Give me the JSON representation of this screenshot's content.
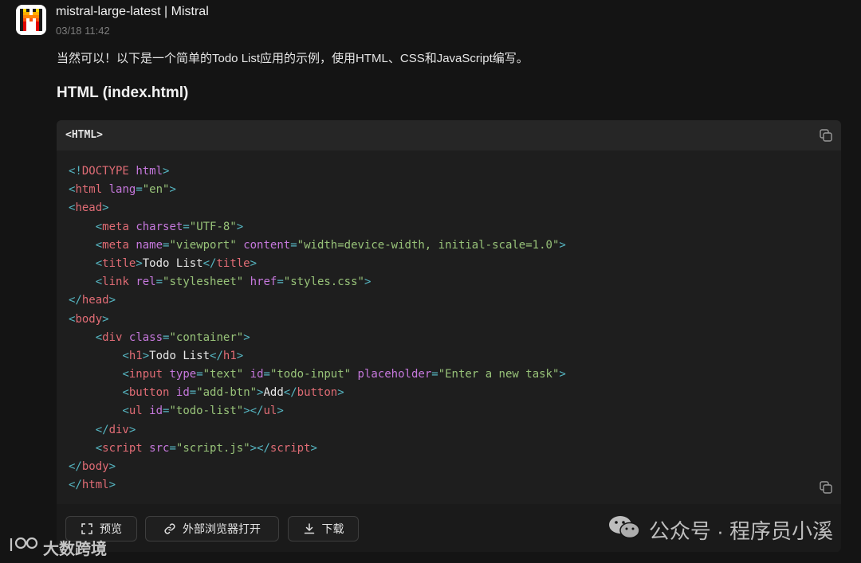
{
  "message": {
    "model_name": "mistral-large-latest | Mistral",
    "time": "03/18 11:42",
    "intro": "当然可以！以下是一个简单的Todo List应用的示例，使用HTML、CSS和JavaScript编写。",
    "section_title": "HTML (index.html)"
  },
  "code_block": {
    "language_label": "<HTML>",
    "lines": [
      [
        [
          "b",
          "<!"
        ],
        [
          "tg",
          "DOCTYPE"
        ],
        [
          "t",
          " "
        ],
        [
          "a",
          "html"
        ],
        [
          "b",
          ">"
        ]
      ],
      [
        [
          "b",
          "<"
        ],
        [
          "tg",
          "html"
        ],
        [
          "t",
          " "
        ],
        [
          "a",
          "lang"
        ],
        [
          "b",
          "="
        ],
        [
          "s",
          "\"en\""
        ],
        [
          "b",
          ">"
        ]
      ],
      [
        [
          "b",
          "<"
        ],
        [
          "tg",
          "head"
        ],
        [
          "b",
          ">"
        ]
      ],
      [
        [
          "t",
          "    "
        ],
        [
          "b",
          "<"
        ],
        [
          "tg",
          "meta"
        ],
        [
          "t",
          " "
        ],
        [
          "a",
          "charset"
        ],
        [
          "b",
          "="
        ],
        [
          "s",
          "\"UTF-8\""
        ],
        [
          "b",
          ">"
        ]
      ],
      [
        [
          "t",
          "    "
        ],
        [
          "b",
          "<"
        ],
        [
          "tg",
          "meta"
        ],
        [
          "t",
          " "
        ],
        [
          "a",
          "name"
        ],
        [
          "b",
          "="
        ],
        [
          "s",
          "\"viewport\""
        ],
        [
          "t",
          " "
        ],
        [
          "a",
          "content"
        ],
        [
          "b",
          "="
        ],
        [
          "s",
          "\"width=device-width, initial-scale=1.0\""
        ],
        [
          "b",
          ">"
        ]
      ],
      [
        [
          "t",
          "    "
        ],
        [
          "b",
          "<"
        ],
        [
          "tg",
          "title"
        ],
        [
          "b",
          ">"
        ],
        [
          "t",
          "Todo List"
        ],
        [
          "b",
          "</"
        ],
        [
          "tg",
          "title"
        ],
        [
          "b",
          ">"
        ]
      ],
      [
        [
          "t",
          "    "
        ],
        [
          "b",
          "<"
        ],
        [
          "tg",
          "link"
        ],
        [
          "t",
          " "
        ],
        [
          "a",
          "rel"
        ],
        [
          "b",
          "="
        ],
        [
          "s",
          "\"stylesheet\""
        ],
        [
          "t",
          " "
        ],
        [
          "a",
          "href"
        ],
        [
          "b",
          "="
        ],
        [
          "s",
          "\"styles.css\""
        ],
        [
          "b",
          ">"
        ]
      ],
      [
        [
          "b",
          "</"
        ],
        [
          "tg",
          "head"
        ],
        [
          "b",
          ">"
        ]
      ],
      [
        [
          "b",
          "<"
        ],
        [
          "tg",
          "body"
        ],
        [
          "b",
          ">"
        ]
      ],
      [
        [
          "t",
          "    "
        ],
        [
          "b",
          "<"
        ],
        [
          "tg",
          "div"
        ],
        [
          "t",
          " "
        ],
        [
          "a",
          "class"
        ],
        [
          "b",
          "="
        ],
        [
          "s",
          "\"container\""
        ],
        [
          "b",
          ">"
        ]
      ],
      [
        [
          "t",
          "        "
        ],
        [
          "b",
          "<"
        ],
        [
          "tg",
          "h1"
        ],
        [
          "b",
          ">"
        ],
        [
          "t",
          "Todo List"
        ],
        [
          "b",
          "</"
        ],
        [
          "tg",
          "h1"
        ],
        [
          "b",
          ">"
        ]
      ],
      [
        [
          "t",
          "        "
        ],
        [
          "b",
          "<"
        ],
        [
          "tg",
          "input"
        ],
        [
          "t",
          " "
        ],
        [
          "a",
          "type"
        ],
        [
          "b",
          "="
        ],
        [
          "s",
          "\"text\""
        ],
        [
          "t",
          " "
        ],
        [
          "a",
          "id"
        ],
        [
          "b",
          "="
        ],
        [
          "s",
          "\"todo-input\""
        ],
        [
          "t",
          " "
        ],
        [
          "a",
          "placeholder"
        ],
        [
          "b",
          "="
        ],
        [
          "s",
          "\"Enter a new task\""
        ],
        [
          "b",
          ">"
        ]
      ],
      [
        [
          "t",
          "        "
        ],
        [
          "b",
          "<"
        ],
        [
          "tg",
          "button"
        ],
        [
          "t",
          " "
        ],
        [
          "a",
          "id"
        ],
        [
          "b",
          "="
        ],
        [
          "s",
          "\"add-btn\""
        ],
        [
          "b",
          ">"
        ],
        [
          "t",
          "Add"
        ],
        [
          "b",
          "</"
        ],
        [
          "tg",
          "button"
        ],
        [
          "b",
          ">"
        ]
      ],
      [
        [
          "t",
          "        "
        ],
        [
          "b",
          "<"
        ],
        [
          "tg",
          "ul"
        ],
        [
          "t",
          " "
        ],
        [
          "a",
          "id"
        ],
        [
          "b",
          "="
        ],
        [
          "s",
          "\"todo-list\""
        ],
        [
          "b",
          "></"
        ],
        [
          "tg",
          "ul"
        ],
        [
          "b",
          ">"
        ]
      ],
      [
        [
          "t",
          "    "
        ],
        [
          "b",
          "</"
        ],
        [
          "tg",
          "div"
        ],
        [
          "b",
          ">"
        ]
      ],
      [
        [
          "t",
          "    "
        ],
        [
          "b",
          "<"
        ],
        [
          "tg",
          "script"
        ],
        [
          "t",
          " "
        ],
        [
          "a",
          "src"
        ],
        [
          "b",
          "="
        ],
        [
          "s",
          "\"script.js\""
        ],
        [
          "b",
          "></"
        ],
        [
          "tg",
          "script"
        ],
        [
          "b",
          ">"
        ]
      ],
      [
        [
          "b",
          "</"
        ],
        [
          "tg",
          "body"
        ],
        [
          "b",
          ">"
        ]
      ],
      [
        [
          "b",
          "</"
        ],
        [
          "tg",
          "html"
        ],
        [
          "b",
          ">"
        ]
      ]
    ]
  },
  "actions": {
    "preview_label": "预览",
    "open_browser_label": "外部浏览器打开",
    "download_label": "下载"
  },
  "watermarks": {
    "left": "大数跨境",
    "right": "公众号 · 程序员小溪"
  },
  "colors": {
    "tag": "#e06c75",
    "bracket": "#56b6c2",
    "attr": "#c678dd",
    "string": "#98c379",
    "text": "#e8e8e8"
  },
  "icons": {
    "avatar": "mistral-logo-icon",
    "copy": "copy-icon",
    "preview": "fullscreen-icon",
    "open_browser": "link-icon",
    "download": "download-icon",
    "wechat": "wechat-icon"
  }
}
